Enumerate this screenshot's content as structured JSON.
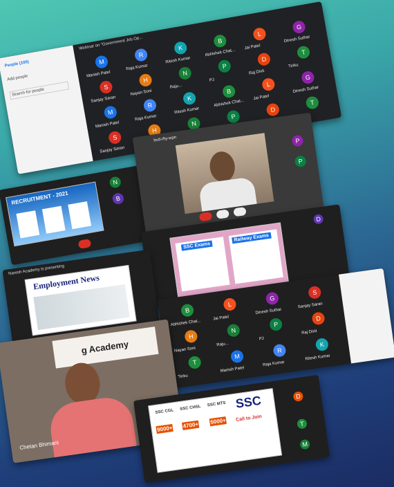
{
  "meeting": {
    "webinar_title": "Webinar on \"Government Job Op...",
    "people_tab": "People (100)",
    "add_people": "Add people",
    "search_placeholder": "Search for people",
    "meeting_code": "bvd-rfty-wpn"
  },
  "participants": [
    {
      "initial": "M",
      "name": "Manish Patel",
      "color": "#1a73e8"
    },
    {
      "initial": "R",
      "name": "Raja Kumar",
      "color": "#4285f4"
    },
    {
      "initial": "K",
      "name": "Ritesh Kumar",
      "color": "#12a4af"
    },
    {
      "initial": "B",
      "name": "Abhishek Chat...",
      "color": "#1e8e3e"
    },
    {
      "initial": "L",
      "name": "Jai Patel",
      "color": "#f4511e"
    },
    {
      "initial": "G",
      "name": "Dinesh Suthar",
      "color": "#8e24aa"
    },
    {
      "initial": "S",
      "name": "Sanjay Saran",
      "color": "#d93025"
    },
    {
      "initial": "H",
      "name": "Nayan Soni",
      "color": "#e67c13"
    },
    {
      "initial": "N",
      "name": "Raju...",
      "color": "#188038"
    },
    {
      "initial": "P",
      "name": "PJ",
      "color": "#0b8043"
    },
    {
      "initial": "D",
      "name": "Raj Dixit",
      "color": "#e8430f"
    },
    {
      "initial": "T",
      "name": "Tinku",
      "color": "#1e8e3e"
    }
  ],
  "posters": {
    "recruitment_title": "RECRUITMENT - 2021",
    "employment_news": "Employment News",
    "ssc_exam": "SSC Exams",
    "railway_exam": "Railway Exams",
    "academy": "g Academy",
    "ssc_big": "SSC",
    "ssc_cgl": "SSC CGL",
    "ssc_chsl": "SSC CHSL",
    "ssc_mts": "SSC MTS",
    "vac1": "9000+",
    "vac2": "4700+",
    "vac3": "5000+",
    "call_to": "Call to Join"
  },
  "presenter": {
    "name": "Chetan Bhimani",
    "presenting_note": "Naresh Academy is presenting",
    "naresh_note": "Naresh Academy is presenting"
  },
  "colors": {
    "accent_red": "#d93025",
    "bg_top": "#4fc7b3",
    "bg_bottom": "#1b2c63"
  }
}
